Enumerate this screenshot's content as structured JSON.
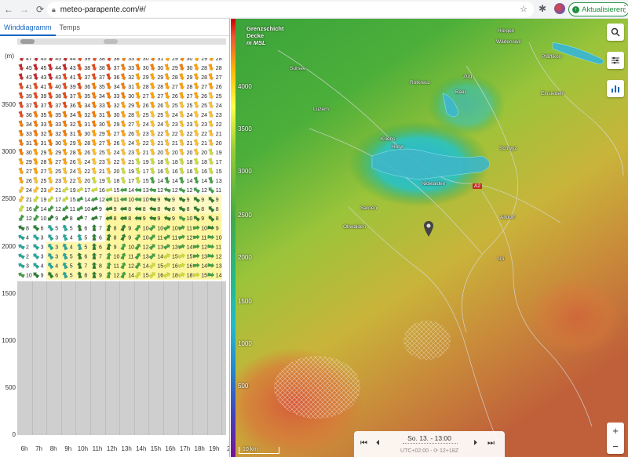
{
  "browser": {
    "url": "meteo-parapente.com/#/",
    "update_label": "Aktualisieren"
  },
  "left_panel": {
    "tabs": [
      {
        "label": "Winddiagramm",
        "active": true
      },
      {
        "label": "Temps",
        "active": false
      }
    ],
    "unit_label": "(m)",
    "y_ticks": [
      "3500",
      "3000",
      "2500",
      "2000",
      "1500",
      "1000",
      "500",
      "0"
    ],
    "x_ticks": [
      "6h",
      "7h",
      "8h",
      "9h",
      "10h",
      "11h",
      "12h",
      "13h",
      "14h",
      "15h",
      "16h",
      "17h",
      "18h",
      "19h",
      "2"
    ]
  },
  "chart_data": {
    "type": "heatmap",
    "title": "",
    "xlabel": "",
    "ylabel": "(m)",
    "ylim": [
      0,
      4000
    ],
    "x": [
      "6h",
      "7h",
      "8h",
      "9h",
      "10h",
      "11h",
      "12h",
      "13h",
      "14h",
      "15h",
      "16h",
      "17h",
      "18h",
      "19h"
    ],
    "y_levels_m": [
      4000,
      3900,
      3800,
      3700,
      3600,
      3500,
      3400,
      3300,
      3200,
      3100,
      3000,
      2900,
      2800,
      2700,
      2600,
      2500,
      2400,
      2300,
      2200,
      2100,
      2000,
      1900,
      1800,
      1700
    ],
    "wind_speed_kmh": [
      [
        47,
        45,
        45,
        44,
        39,
        38,
        38,
        33,
        30,
        31,
        29,
        30,
        29,
        28
      ],
      [
        45,
        45,
        44,
        43,
        38,
        38,
        37,
        33,
        30,
        30,
        29,
        30,
        28,
        28
      ],
      [
        43,
        43,
        43,
        41,
        37,
        37,
        36,
        32,
        29,
        29,
        28,
        29,
        28,
        27
      ],
      [
        41,
        41,
        40,
        39,
        36,
        35,
        34,
        31,
        28,
        28,
        27,
        28,
        27,
        26
      ],
      [
        39,
        39,
        38,
        37,
        35,
        34,
        33,
        30,
        27,
        27,
        26,
        27,
        26,
        25
      ],
      [
        37,
        37,
        37,
        36,
        34,
        33,
        32,
        29,
        26,
        26,
        25,
        25,
        25,
        24
      ],
      [
        36,
        35,
        35,
        34,
        32,
        31,
        30,
        28,
        25,
        25,
        24,
        24,
        24,
        23
      ],
      [
        34,
        33,
        33,
        32,
        31,
        30,
        29,
        27,
        24,
        24,
        23,
        23,
        23,
        22
      ],
      [
        33,
        32,
        32,
        31,
        30,
        29,
        27,
        26,
        23,
        22,
        22,
        22,
        22,
        21
      ],
      [
        31,
        31,
        30,
        29,
        28,
        27,
        26,
        24,
        22,
        21,
        21,
        21,
        21,
        20
      ],
      [
        30,
        29,
        29,
        28,
        26,
        25,
        24,
        23,
        21,
        20,
        20,
        20,
        20,
        19
      ],
      [
        29,
        28,
        27,
        26,
        24,
        23,
        22,
        21,
        19,
        18,
        18,
        18,
        18,
        17
      ],
      [
        27,
        27,
        25,
        24,
        22,
        21,
        20,
        19,
        17,
        16,
        16,
        16,
        16,
        15
      ],
      [
        26,
        25,
        23,
        22,
        20,
        19,
        18,
        17,
        15,
        14,
        14,
        14,
        14,
        13
      ],
      [
        24,
        23,
        21,
        19,
        17,
        16,
        15,
        14,
        13,
        12,
        12,
        12,
        12,
        11
      ],
      [
        21,
        19,
        17,
        15,
        14,
        12,
        11,
        10,
        10,
        9,
        9,
        9,
        9,
        9
      ],
      [
        16,
        14,
        12,
        11,
        10,
        9,
        9,
        8,
        8,
        8,
        8,
        8,
        8,
        8
      ],
      [
        12,
        10,
        9,
        8,
        7,
        7,
        8,
        8,
        9,
        9,
        9,
        10,
        9,
        8
      ],
      [
        8,
        6,
        5,
        5,
        6,
        7,
        8,
        9,
        10,
        10,
        10,
        11,
        10,
        9
      ],
      [
        4,
        3,
        3,
        4,
        5,
        6,
        8,
        9,
        10,
        11,
        11,
        12,
        11,
        10
      ],
      [
        2,
        3,
        3,
        4,
        5,
        6,
        9,
        10,
        12,
        13,
        13,
        14,
        12,
        11
      ],
      [
        2,
        3,
        3,
        5,
        6,
        7,
        10,
        11,
        13,
        14,
        15,
        15,
        13,
        12
      ],
      [
        3,
        4,
        4,
        5,
        7,
        8,
        11,
        12,
        14,
        15,
        16,
        16,
        14,
        13
      ],
      [
        10,
        9,
        6,
        5,
        8,
        9,
        12,
        14,
        15,
        16,
        18,
        18,
        15,
        14
      ]
    ]
  },
  "map": {
    "legend_title_1": "Grenzschicht",
    "legend_title_2": "Decke",
    "legend_title_3": "m MSL",
    "ticks": [
      "4000",
      "3500",
      "3000",
      "2500",
      "2000",
      "1500",
      "1000",
      "500"
    ],
    "places": [
      {
        "name": "Luzern"
      },
      {
        "name": "Rotkreuz"
      },
      {
        "name": "Zug"
      },
      {
        "name": "Baar"
      },
      {
        "name": "Wädenswil"
      },
      {
        "name": "Horgen"
      },
      {
        "name": "Einsiedeln"
      },
      {
        "name": "Schwyz"
      },
      {
        "name": "Nidwalden"
      },
      {
        "name": "Obwalden"
      },
      {
        "name": "Sarnen"
      },
      {
        "name": "Altdorf"
      },
      {
        "name": "Uri"
      },
      {
        "name": "Kriens"
      },
      {
        "name": "Horw"
      },
      {
        "name": "Sursee"
      },
      {
        "name": "Pfäffikon"
      },
      {
        "name": "A2"
      }
    ],
    "time_label": "So. 13. - 13:00",
    "utc_label": "UTC+02:00 - ⟳ 12+18Z",
    "scale_label": "10 km",
    "colors": {
      "accent": "#1565c0",
      "update_green": "#1e8e3e"
    }
  }
}
